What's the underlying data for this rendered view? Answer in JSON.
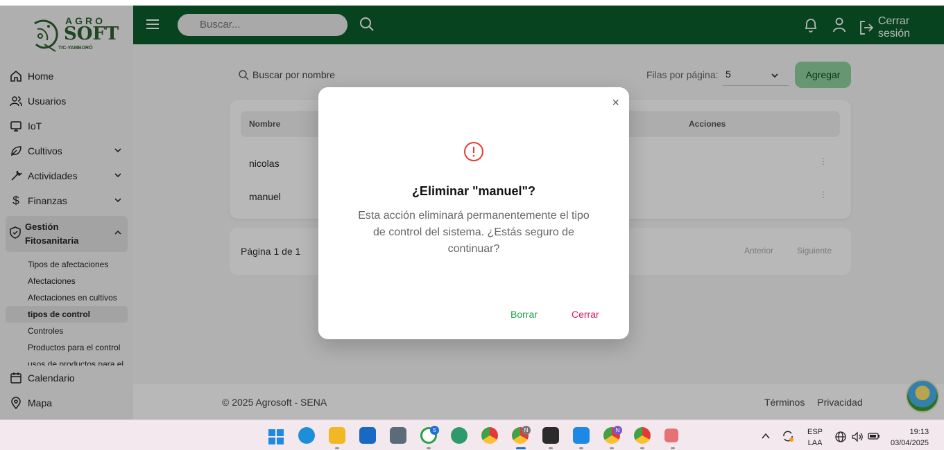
{
  "app": {
    "logo": {
      "brand_top": "AGRO",
      "brand_main": "SOFT",
      "brand_sub": "TIC-YAMBORÓ"
    }
  },
  "header": {
    "search_placeholder": "Buscar...",
    "logout_label": "Cerrar sesión",
    "bg_color": "#0a5e2a"
  },
  "sidebar": {
    "items": [
      {
        "label": "Home",
        "icon": "home-icon"
      },
      {
        "label": "Usuarios",
        "icon": "users-icon"
      },
      {
        "label": "IoT",
        "icon": "monitor-icon"
      },
      {
        "label": "Cultivos",
        "icon": "leaf-icon"
      },
      {
        "label": "Actividades",
        "icon": "wrench-icon"
      },
      {
        "label": "Finanzas",
        "icon": "dollar-icon"
      }
    ],
    "group": {
      "label_line1": "Gestión",
      "label_line2": "Fitosanitaria",
      "subitems": [
        "Tipos de afectaciones",
        "Afectaciones",
        "Afectaciones en cultivos",
        "tipos de control",
        "Controles",
        "Productos para el control",
        "usos de productos para el"
      ]
    },
    "bottom_items": [
      {
        "label": "Calendario",
        "icon": "calendar-icon"
      },
      {
        "label": "Mapa",
        "icon": "map-pin-icon"
      }
    ]
  },
  "table_view": {
    "search_placeholder": "Buscar por nombre",
    "rows_per_page_label": "Filas por página:",
    "rows_per_page_value": "5",
    "add_button": "Agregar",
    "columns": [
      "Nombre",
      "Acciones"
    ],
    "rows": [
      "nicolas",
      "manuel"
    ],
    "pagination_text": "Página 1 de 1",
    "prev_label": "Anterior",
    "next_label": "Siguiente"
  },
  "footer": {
    "copyright": "© 2025 Agrosoft - SENA",
    "terms": "Términos",
    "privacy": "Privacidad"
  },
  "modal": {
    "title": "¿Eliminar \"manuel\"?",
    "message": "Esta acción eliminará permanentemente el tipo de control del sistema. ¿Estás seguro de continuar?",
    "confirm_label": "Borrar",
    "cancel_label": "Cerrar",
    "close_symbol": "×"
  },
  "taskbar": {
    "lang_line1": "ESP",
    "lang_line2": "LAA",
    "time": "19:13",
    "date": "03/04/2025",
    "whatsapp_badge": "5",
    "chrome_badge": "N",
    "chrome2_badge": "N"
  }
}
